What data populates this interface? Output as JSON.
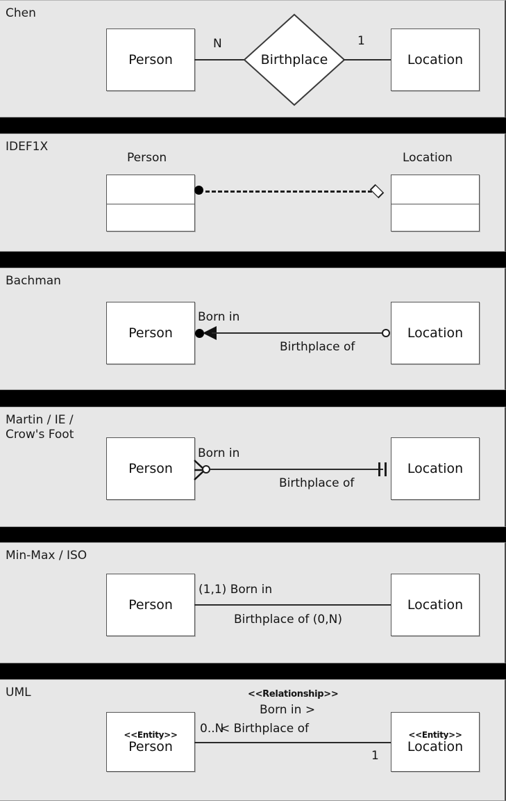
{
  "page": {
    "background": "#000000",
    "panel_background": "#e7e7e7",
    "box_fill": "#ffffff",
    "stroke": "#2b2b2b",
    "entity_person": "Person",
    "entity_location": "Location"
  },
  "panels": [
    {
      "id": "chen",
      "title": "Chen",
      "entities": [
        "Person",
        "Location"
      ],
      "relationship": "Birthplace",
      "cardinality_left": "N",
      "cardinality_right": "1"
    },
    {
      "id": "idef1x",
      "title": "IDEF1X",
      "entities": [
        "Person",
        "Location"
      ],
      "label_person": "Person",
      "label_location": "Location"
    },
    {
      "id": "bachman",
      "title": "Bachman",
      "entities": [
        "Person",
        "Location"
      ],
      "role_above": "Born in",
      "role_below": "Birthplace of"
    },
    {
      "id": "martin",
      "title": "Martin / IE /\nCrow's Foot",
      "entities": [
        "Person",
        "Location"
      ],
      "role_above": "Born in",
      "role_below": "Birthplace of"
    },
    {
      "id": "minmax",
      "title": "Min-Max / ISO",
      "entities": [
        "Person",
        "Location"
      ],
      "role_above": "(1,1) Born in",
      "role_below": "Birthplace of (0,N)"
    },
    {
      "id": "uml",
      "title": "UML",
      "entities": [
        "Person",
        "Location"
      ],
      "stereotype_entity": "<<Entity>>",
      "stereotype_relationship": "<<Relationship>>",
      "role_above": "Born in >",
      "role_below": "< Birthplace of",
      "multiplicity_left": "0..N",
      "multiplicity_right": "1"
    }
  ]
}
